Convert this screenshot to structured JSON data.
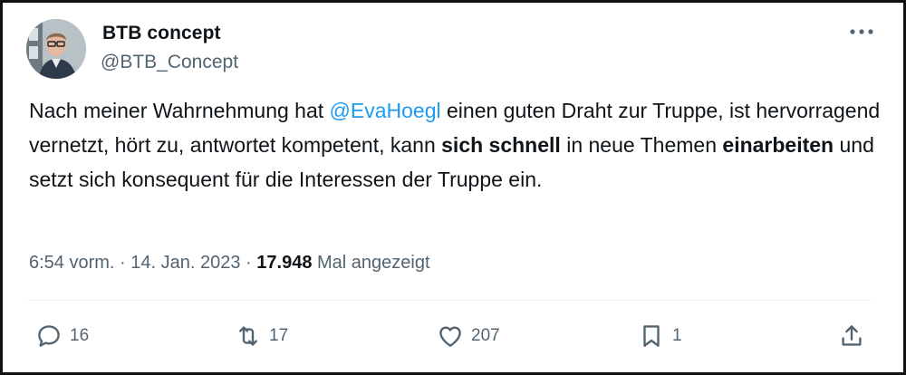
{
  "author": {
    "name": "BTB concept",
    "handle": "@BTB_Concept"
  },
  "tweet": {
    "text_1": "Nach meiner Wahrnehmung hat ",
    "mention": "@EvaHoegl",
    "text_2": " einen guten Draht zur Truppe, ist hervorragend vernetzt, hört zu, antwortet kompetent, kann ",
    "bold_1": "sich schnell",
    "text_3": " in neue Themen ",
    "bold_2": "einarbeiten",
    "text_4": " und setzt sich konsequent für die Interessen der Truppe ein."
  },
  "meta": {
    "time": "6:54 vorm.",
    "sep1": " · ",
    "date": "14. Jan. 2023",
    "sep2": " · ",
    "views": "17.948",
    "views_label": " Mal angezeigt"
  },
  "actions": {
    "replies": "16",
    "retweets": "17",
    "likes": "207",
    "bookmarks": "1"
  },
  "icons": [
    "more-icon",
    "reply-icon",
    "retweet-icon",
    "like-icon",
    "bookmark-icon",
    "share-icon"
  ],
  "colors": {
    "accent": "#1d9bf0",
    "text": "#0f1419",
    "muted": "#536471"
  }
}
